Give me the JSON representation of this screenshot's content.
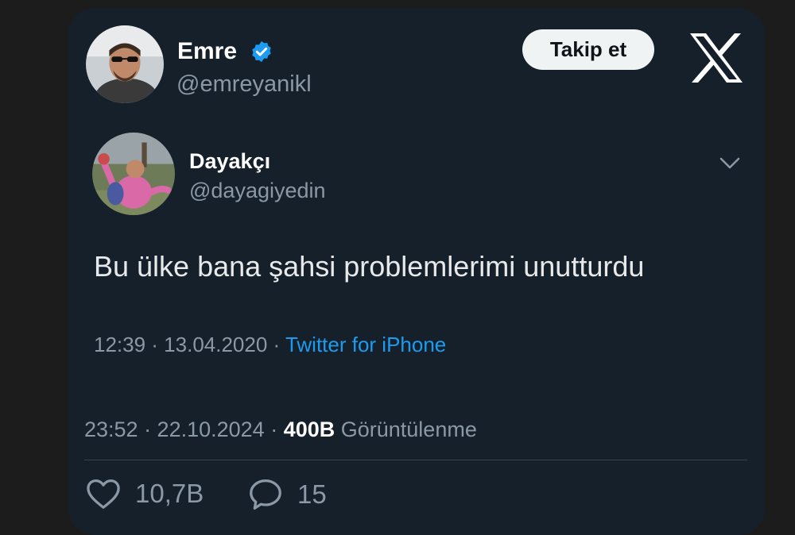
{
  "tweet": {
    "author": {
      "name": "Emre",
      "handle": "@emreyanikl",
      "verified": true
    },
    "follow_label": "Takip et",
    "meta": {
      "time_date": "23:52 · 22.10.2024 · ",
      "views_count": "400B",
      "views_label": "Görüntülenme"
    },
    "actions": {
      "likes": "10,7B",
      "replies": "15"
    }
  },
  "quoted": {
    "author": {
      "name": "Dayakçı",
      "handle": "@dayagiyedin"
    },
    "text": "Bu ülke bana şahsi problemlerimi unutturdu",
    "meta": {
      "time_date": "12:39 · 13.04.2020 · ",
      "source": "Twitter for iPhone"
    }
  },
  "colors": {
    "card_bg": "#15202b",
    "verified": "#1d9bf0",
    "link": "#1d9bf0",
    "muted": "#8b98a5"
  },
  "icons": [
    "verified-badge-icon",
    "x-logo-icon",
    "chevron-down-icon",
    "heart-icon",
    "reply-bubble-icon"
  ]
}
